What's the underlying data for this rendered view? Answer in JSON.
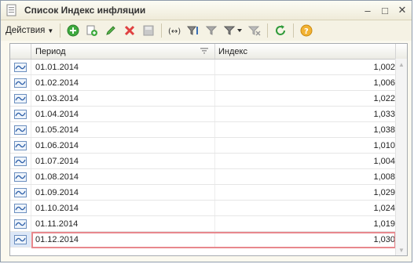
{
  "window": {
    "title": "Список Индекс инфляции",
    "controls": {
      "minimize": "–",
      "maximize": "□",
      "close": "✕"
    }
  },
  "toolbar": {
    "actions_label": "Действия",
    "buttons": [
      {
        "name": "add-icon",
        "glyph": "+"
      },
      {
        "name": "copy-icon",
        "glyph": ""
      },
      {
        "name": "edit-icon",
        "glyph": "✎"
      },
      {
        "name": "delete-icon",
        "glyph": "✕"
      },
      {
        "name": "save-icon",
        "glyph": ""
      },
      {
        "name": "interval-icon",
        "glyph": "(↔)"
      },
      {
        "name": "filter-icon",
        "glyph": ""
      },
      {
        "name": "filter-clear-icon",
        "glyph": ""
      },
      {
        "name": "filter-dropdown-icon",
        "glyph": ""
      },
      {
        "name": "filter-off-icon",
        "glyph": ""
      },
      {
        "name": "refresh-icon",
        "glyph": "⟳"
      },
      {
        "name": "help-icon",
        "glyph": "?"
      }
    ]
  },
  "table": {
    "columns": {
      "period": "Период",
      "index": "Индекс"
    },
    "rows": [
      {
        "period": "01.01.2014",
        "index": "1,002"
      },
      {
        "period": "01.02.2014",
        "index": "1,006"
      },
      {
        "period": "01.03.2014",
        "index": "1,022"
      },
      {
        "period": "01.04.2014",
        "index": "1,033"
      },
      {
        "period": "01.05.2014",
        "index": "1,038"
      },
      {
        "period": "01.06.2014",
        "index": "1,010"
      },
      {
        "period": "01.07.2014",
        "index": "1,004"
      },
      {
        "period": "01.08.2014",
        "index": "1,008"
      },
      {
        "period": "01.09.2014",
        "index": "1,029"
      },
      {
        "period": "01.10.2014",
        "index": "1,024"
      },
      {
        "period": "01.11.2014",
        "index": "1,019"
      },
      {
        "period": "01.12.2014",
        "index": "1,030"
      }
    ],
    "selected_index": 11
  },
  "colors": {
    "window_bg": "#fbf9ef",
    "selection_border": "#e8888d",
    "row_icon": "#3a6fb5"
  }
}
